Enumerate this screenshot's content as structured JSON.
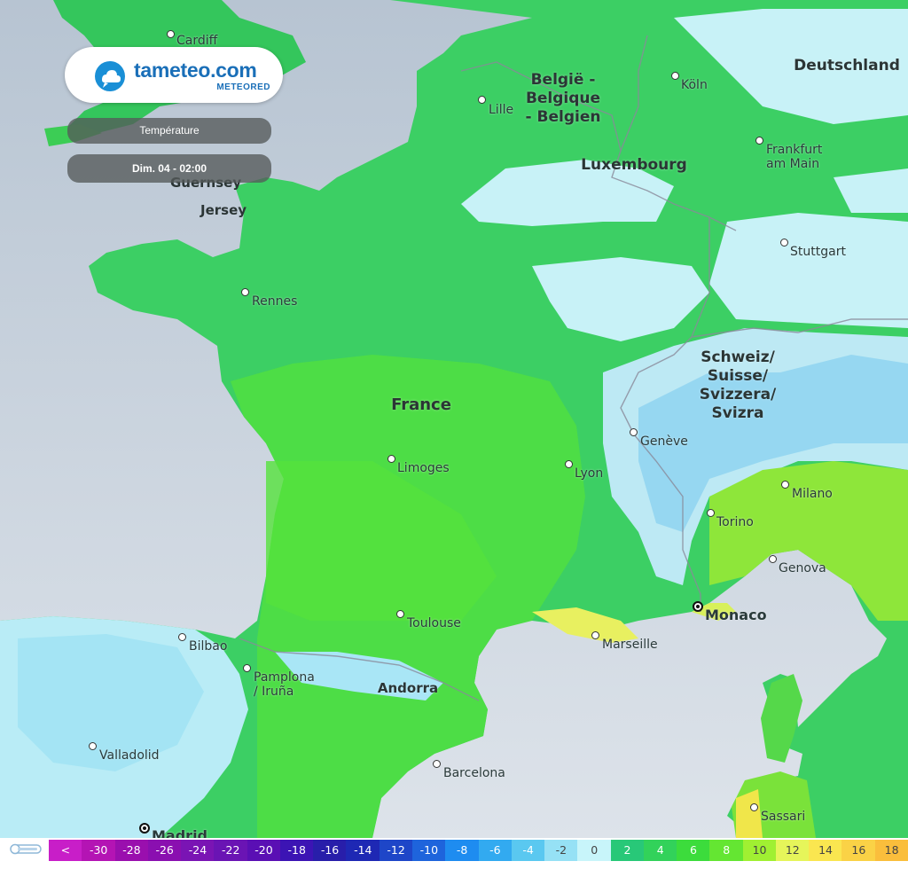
{
  "brand": {
    "name": "tameteo.com",
    "sub": "METEORED"
  },
  "controls": {
    "variable": "Température",
    "datetime": "Dim. 04 - 02:00"
  },
  "countries": [
    {
      "name": "België -\nBelgique\n- Belgien"
    },
    {
      "name": "Deutschland"
    },
    {
      "name": "Luxembourg"
    },
    {
      "name": "France"
    },
    {
      "name": "Schweiz/\nSuisse/\nSvizzera/\nSvizra"
    },
    {
      "name": "Andorra"
    },
    {
      "name": "Guernsey"
    },
    {
      "name": "Jersey"
    }
  ],
  "cities": [
    {
      "name": "Cardiff"
    },
    {
      "name": "Lille"
    },
    {
      "name": "Köln"
    },
    {
      "name": "Frankfurt\nam Main"
    },
    {
      "name": "Stuttgart"
    },
    {
      "name": "Rennes"
    },
    {
      "name": "Limoges"
    },
    {
      "name": "Lyon"
    },
    {
      "name": "Genève"
    },
    {
      "name": "Milano"
    },
    {
      "name": "Torino"
    },
    {
      "name": "Genova"
    },
    {
      "name": "Monaco"
    },
    {
      "name": "Marseille"
    },
    {
      "name": "Toulouse"
    },
    {
      "name": "Bilbao"
    },
    {
      "name": "Pamplona\n/ Iruña"
    },
    {
      "name": "Valladolid"
    },
    {
      "name": "Barcelona"
    },
    {
      "name": "Sassari"
    },
    {
      "name": "Madrid"
    }
  ],
  "legend": {
    "icon": "thermometer-icon",
    "cells": [
      {
        "label": "<",
        "color": "#c81ec8"
      },
      {
        "label": "-30",
        "color": "#b414b4"
      },
      {
        "label": "-28",
        "color": "#9a0fae"
      },
      {
        "label": "-26",
        "color": "#8a0fb0"
      },
      {
        "label": "-24",
        "color": "#7a14b4"
      },
      {
        "label": "-22",
        "color": "#6a14b4"
      },
      {
        "label": "-20",
        "color": "#5a0fb4"
      },
      {
        "label": "-18",
        "color": "#3c14b4"
      },
      {
        "label": "-16",
        "color": "#281eaa"
      },
      {
        "label": "-14",
        "color": "#1e28b4"
      },
      {
        "label": "-12",
        "color": "#1e46c8"
      },
      {
        "label": "-10",
        "color": "#1e64dc"
      },
      {
        "label": "-8",
        "color": "#1e8cf0"
      },
      {
        "label": "-6",
        "color": "#32aaf0"
      },
      {
        "label": "-4",
        "color": "#5ac8f0"
      },
      {
        "label": "-2",
        "color": "#96e1f5"
      },
      {
        "label": "0",
        "color": "#c8f5fa"
      },
      {
        "label": "2",
        "color": "#28c878"
      },
      {
        "label": "4",
        "color": "#32d25a"
      },
      {
        "label": "6",
        "color": "#3cdc3c"
      },
      {
        "label": "8",
        "color": "#64e632"
      },
      {
        "label": "10",
        "color": "#a0f032"
      },
      {
        "label": "12",
        "color": "#e6f55a"
      },
      {
        "label": "14",
        "color": "#fae650"
      },
      {
        "label": "16",
        "color": "#fad246"
      },
      {
        "label": "18",
        "color": "#fabe3c"
      }
    ]
  }
}
